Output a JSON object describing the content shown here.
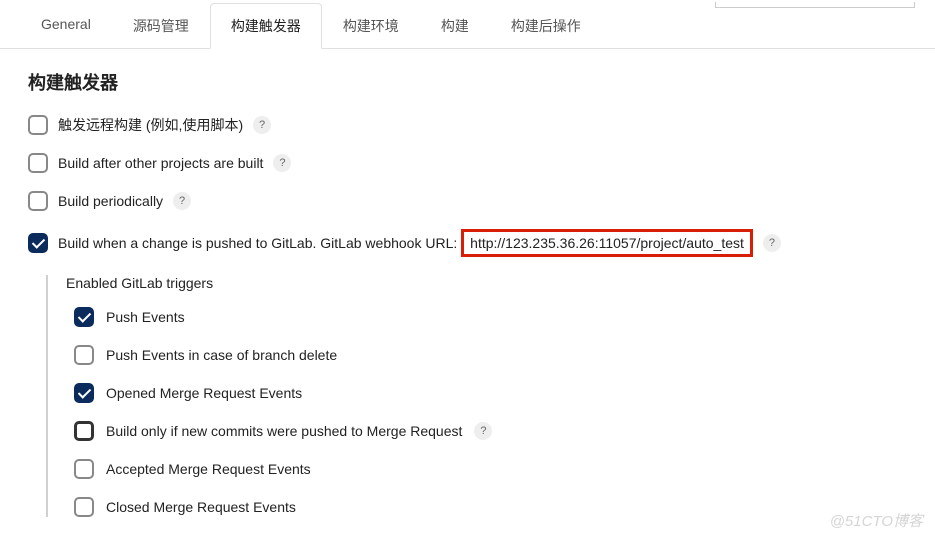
{
  "tabs": {
    "general": "General",
    "source": "源码管理",
    "triggers": "构建触发器",
    "env": "构建环境",
    "build": "构建",
    "post": "构建后操作"
  },
  "section": {
    "title": "构建触发器"
  },
  "options": {
    "remote": "触发远程构建 (例如,使用脚本)",
    "after_projects": "Build after other projects are built",
    "periodically": "Build periodically",
    "gitlab_push_prefix": "Build when a change is pushed to GitLab. GitLab webhook URL: ",
    "gitlab_push_url": "http://123.235.36.26:11057/project/auto_test"
  },
  "sub": {
    "title": "Enabled GitLab triggers",
    "push_events": "Push Events",
    "push_branch_delete": "Push Events in case of branch delete",
    "opened_mr": "Opened Merge Request Events",
    "build_new_commits": "Build only if new commits were pushed to Merge Request",
    "accepted_mr": "Accepted Merge Request Events",
    "closed_mr": "Closed Merge Request Events"
  },
  "help": "?",
  "watermark": "@51CTO博客"
}
